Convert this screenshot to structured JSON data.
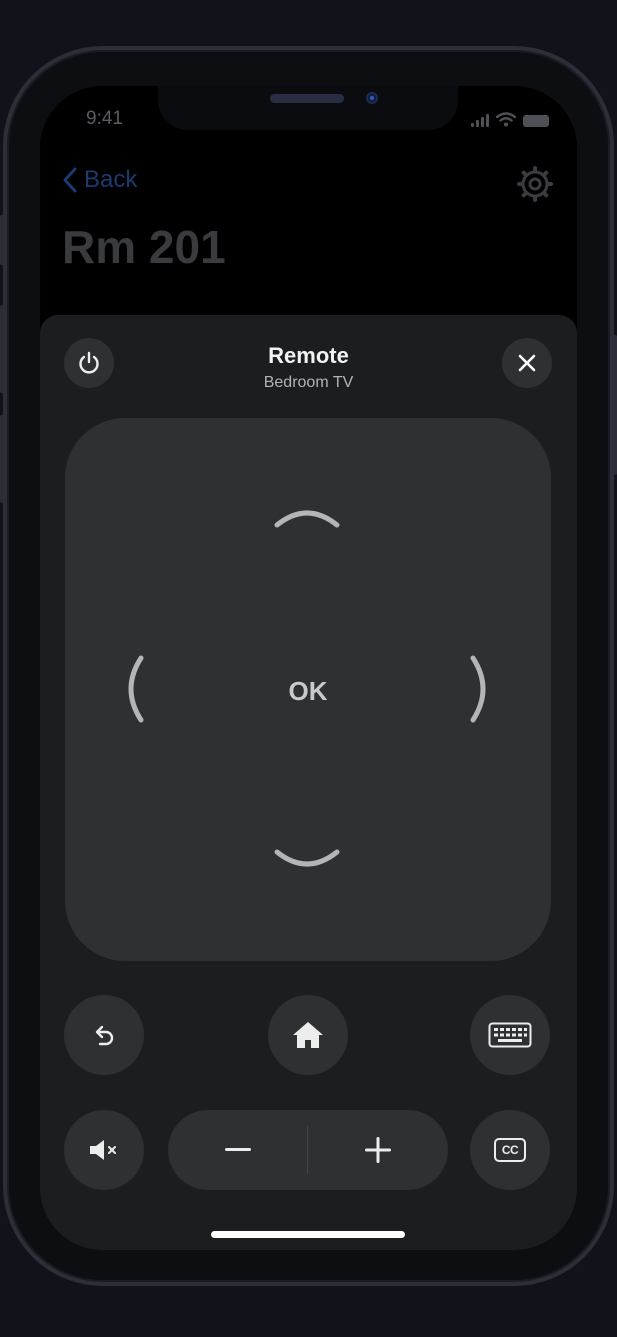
{
  "status_bar": {
    "time": "9:41",
    "signal_icon": "cellular-signal-icon",
    "wifi_icon": "wifi-icon",
    "battery_icon": "battery-icon"
  },
  "background_screen": {
    "back_label": "Back",
    "back_icon": "chevron-left-icon",
    "settings_icon": "gear-icon",
    "title": "Rm 201"
  },
  "remote_sheet": {
    "title": "Remote",
    "subtitle": "Bedroom TV",
    "power_icon": "power-icon",
    "close_icon": "close-icon",
    "dpad": {
      "ok_label": "OK",
      "up_icon": "chevron-up-icon",
      "down_icon": "chevron-down-icon",
      "left_icon": "chevron-left-icon",
      "right_icon": "chevron-right-icon"
    },
    "controls": {
      "back_icon": "undo-arrow-icon",
      "home_icon": "home-icon",
      "keyboard_icon": "keyboard-icon",
      "mute_icon": "speaker-muted-icon",
      "volume_down_label": "−",
      "volume_up_label": "+",
      "captions_label": "CC"
    }
  },
  "colors": {
    "page_background": "#11131a",
    "sheet_background": "#1c1d20",
    "button_background": "#2f3034",
    "back_link_dimmed": "#1b3a6e",
    "text_primary": "#f2f2f2"
  }
}
